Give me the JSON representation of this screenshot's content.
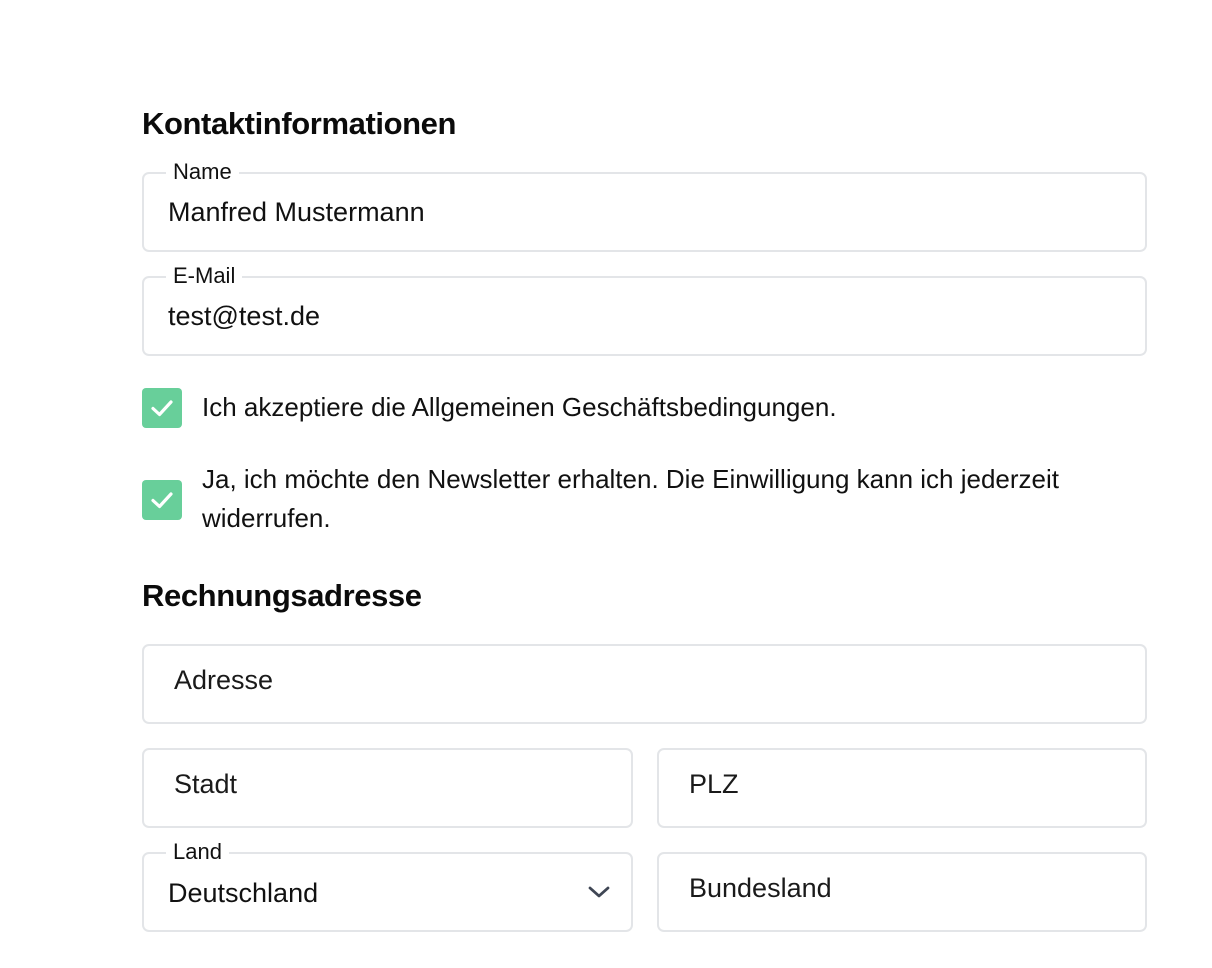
{
  "contact": {
    "heading": "Kontaktinformationen",
    "name": {
      "label": "Name",
      "value": "Manfred Mustermann"
    },
    "email": {
      "label": "E-Mail",
      "value": "test@test.de"
    },
    "terms_checkbox": {
      "checked": true,
      "label": "Ich akzeptiere die Allgemeinen Geschäftsbedingungen."
    },
    "newsletter_checkbox": {
      "checked": true,
      "label": "Ja, ich möchte den Newsletter erhalten. Die Einwilligung kann ich jederzeit widerrufen."
    }
  },
  "billing": {
    "heading": "Rechnungsadresse",
    "address": {
      "placeholder": "Adresse"
    },
    "city": {
      "placeholder": "Stadt"
    },
    "zip": {
      "placeholder": "PLZ"
    },
    "country": {
      "label": "Land",
      "value": "Deutschland"
    },
    "state": {
      "placeholder": "Bundesland"
    }
  },
  "icons": {
    "checkbox_check": "check-icon",
    "select_chevron": "chevron-down-icon"
  },
  "colors": {
    "checkbox_fill": "#68cf9a",
    "field_border": "#e3e5e8",
    "chevron": "#3f4654"
  }
}
